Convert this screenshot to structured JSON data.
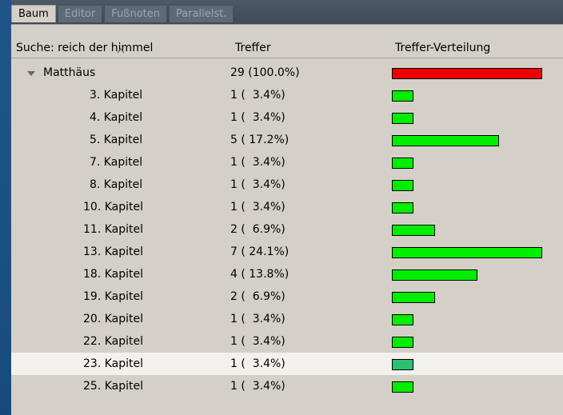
{
  "tabs": [
    {
      "label": "Baum",
      "active": true
    },
    {
      "label": "Editor",
      "active": false
    },
    {
      "label": "Fußnoten",
      "active": false
    },
    {
      "label": "Parallelst.",
      "active": false
    }
  ],
  "header": {
    "search_label": "Suche: reich der himmel",
    "hits_label": "Treffer",
    "distribution_label": "Treffer-Verteilung"
  },
  "colors": {
    "bar_root": "#ee0000",
    "bar_child": "#00ee00",
    "bar_selected": "#2fbf72"
  },
  "tree": {
    "root": {
      "name": "Matthäus",
      "hits": "29 (100.0%)",
      "fraction": 1.0,
      "expanded": true
    },
    "children": [
      {
        "name": "3. Kapitel",
        "hits": "1 (  3.4%)",
        "fraction": 0.143
      },
      {
        "name": "4. Kapitel",
        "hits": "1 (  3.4%)",
        "fraction": 0.143
      },
      {
        "name": "5. Kapitel",
        "hits": "5 ( 17.2%)",
        "fraction": 0.714
      },
      {
        "name": "7. Kapitel",
        "hits": "1 (  3.4%)",
        "fraction": 0.143
      },
      {
        "name": "8. Kapitel",
        "hits": "1 (  3.4%)",
        "fraction": 0.143
      },
      {
        "name": "10. Kapitel",
        "hits": "1 (  3.4%)",
        "fraction": 0.143
      },
      {
        "name": "11. Kapitel",
        "hits": "2 (  6.9%)",
        "fraction": 0.286
      },
      {
        "name": "13. Kapitel",
        "hits": "7 ( 24.1%)",
        "fraction": 1.0
      },
      {
        "name": "18. Kapitel",
        "hits": "4 ( 13.8%)",
        "fraction": 0.571
      },
      {
        "name": "19. Kapitel",
        "hits": "2 (  6.9%)",
        "fraction": 0.286
      },
      {
        "name": "20. Kapitel",
        "hits": "1 (  3.4%)",
        "fraction": 0.143
      },
      {
        "name": "22. Kapitel",
        "hits": "1 (  3.4%)",
        "fraction": 0.143
      },
      {
        "name": "23. Kapitel",
        "hits": "1 (  3.4%)",
        "fraction": 0.143,
        "selected": true
      },
      {
        "name": "25. Kapitel",
        "hits": "1 (  3.4%)",
        "fraction": 0.143
      }
    ]
  }
}
